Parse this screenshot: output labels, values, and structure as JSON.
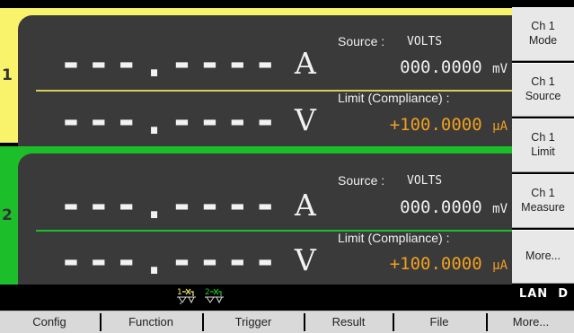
{
  "colors": {
    "channel1": "#f8f36a",
    "channel2": "#1cbf2a",
    "panel_bg": "#3a3a3a",
    "limit_value": "#f0a020",
    "softkey_bg": "#e8e8e8"
  },
  "channels": [
    {
      "number": "1",
      "current_reading": "---.----",
      "current_unit": "A",
      "voltage_reading": "---.----",
      "voltage_unit": "V",
      "source_label": "Source :",
      "source_mode": "VOLTS",
      "source_value": "000.0000",
      "source_unit": "mV",
      "limit_label": "Limit (Compliance) :",
      "limit_value": "+100.0000",
      "limit_unit": "μA"
    },
    {
      "number": "2",
      "current_reading": "---.----",
      "current_unit": "A",
      "voltage_reading": "---.----",
      "voltage_unit": "V",
      "source_label": "Source :",
      "source_mode": "VOLTS",
      "source_value": "000.0000",
      "source_unit": "mV",
      "limit_label": "Limit (Compliance) :",
      "limit_value": "+100.0000",
      "limit_unit": "μA"
    }
  ],
  "softkeys": [
    {
      "line1": "Ch 1",
      "line2": "Mode"
    },
    {
      "line1": "Ch 1",
      "line2": "Source"
    },
    {
      "line1": "Ch 1",
      "line2": "Limit"
    },
    {
      "line1": "Ch 1",
      "line2": "Measure"
    },
    {
      "line1": "More...",
      "line2": ""
    }
  ],
  "status": {
    "ch1_indicator": "1",
    "ch2_indicator": "2",
    "lan": "LAN",
    "lan_state": "D"
  },
  "function_keys": [
    "Config",
    "Function",
    "Trigger",
    "Result",
    "File",
    "More..."
  ]
}
